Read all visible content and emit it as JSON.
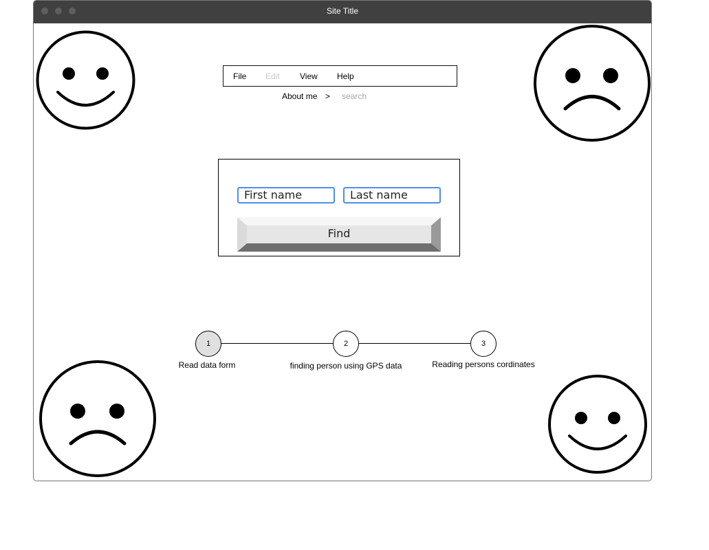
{
  "window": {
    "title": "Site Title"
  },
  "menu": {
    "items": [
      {
        "label": "File",
        "enabled": true
      },
      {
        "label": "Edit",
        "enabled": false
      },
      {
        "label": "View",
        "enabled": true
      },
      {
        "label": "Help",
        "enabled": true
      }
    ]
  },
  "breadcrumb": {
    "items": [
      "About me",
      "search"
    ],
    "separator": ">"
  },
  "form": {
    "first_name_placeholder": "First name",
    "last_name_placeholder": "Last name",
    "find_label": "Find"
  },
  "stepper": {
    "steps": [
      {
        "number": "1",
        "label": "Read data form",
        "active": true
      },
      {
        "number": "2",
        "label": "finding person using GPS data",
        "active": false
      },
      {
        "number": "3",
        "label": "Reading persons cordinates",
        "active": false
      }
    ]
  },
  "faces": [
    {
      "name": "happy-face-icon",
      "mood": "happy"
    },
    {
      "name": "sad-face-icon",
      "mood": "sad"
    },
    {
      "name": "sad-face-icon",
      "mood": "sad"
    },
    {
      "name": "happy-face-icon",
      "mood": "happy"
    }
  ],
  "colors": {
    "titlebar": "#404040",
    "field_border": "#4d8ee8",
    "active_step": "#e0e0e0"
  }
}
